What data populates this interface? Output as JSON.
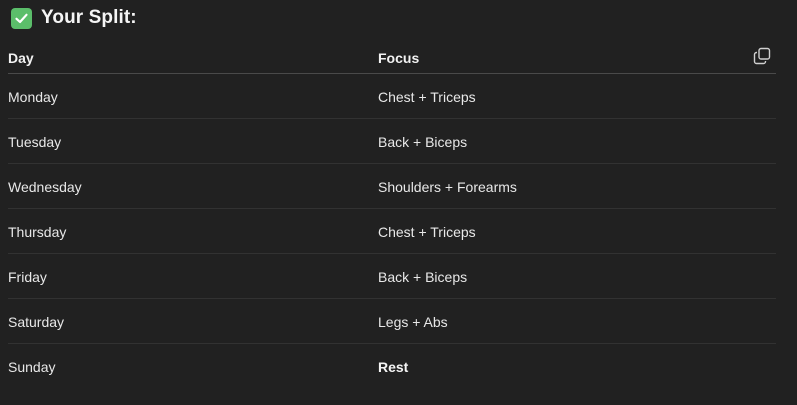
{
  "heading": {
    "icon": "check-box-icon",
    "text": "Your Split:",
    "icon_color": "#5bbe6a"
  },
  "table": {
    "columns": [
      "Day",
      "Focus"
    ],
    "copy_icon": "copy-icon",
    "rows": [
      {
        "day": "Monday",
        "focus": "Chest + Triceps",
        "bold": false
      },
      {
        "day": "Tuesday",
        "focus": "Back + Biceps",
        "bold": false
      },
      {
        "day": "Wednesday",
        "focus": "Shoulders + Forearms",
        "bold": false
      },
      {
        "day": "Thursday",
        "focus": "Chest + Triceps",
        "bold": false
      },
      {
        "day": "Friday",
        "focus": "Back + Biceps",
        "bold": false
      },
      {
        "day": "Saturday",
        "focus": "Legs + Abs",
        "bold": false
      },
      {
        "day": "Sunday",
        "focus": "Rest",
        "bold": true
      }
    ]
  }
}
